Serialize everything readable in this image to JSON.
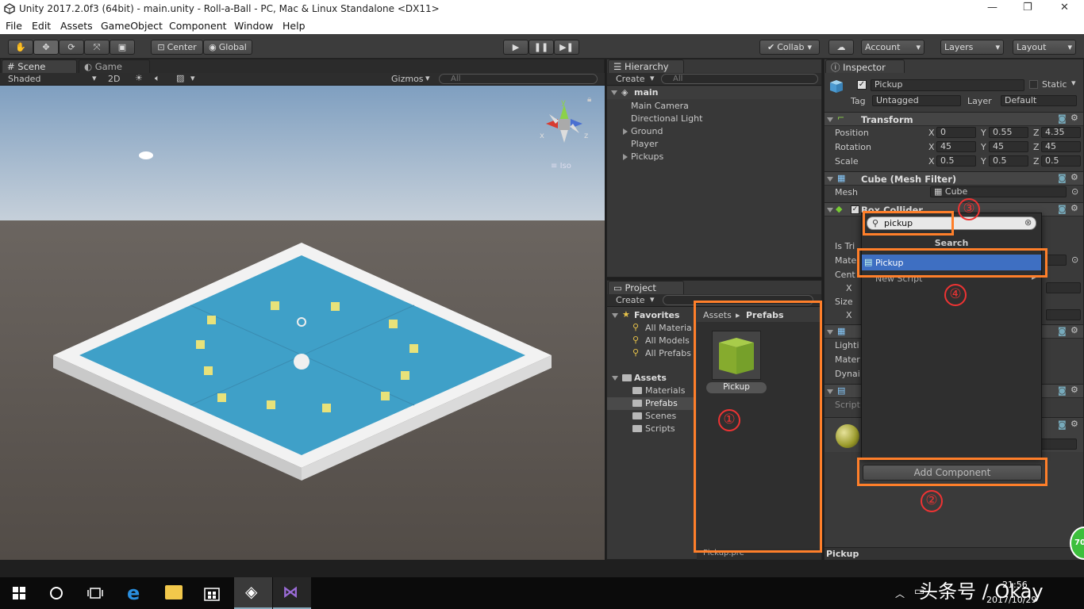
{
  "window": {
    "title": "Unity 2017.2.0f3 (64bit) - main.unity - Roll-a-Ball - PC, Mac & Linux Standalone <DX11>"
  },
  "menu": [
    "File",
    "Edit",
    "Assets",
    "GameObject",
    "Component",
    "Window",
    "Help"
  ],
  "toolbar": {
    "pivot": "Center",
    "space": "Global",
    "collab": "Collab",
    "account": "Account",
    "layers": "Layers",
    "layout": "Layout"
  },
  "scene": {
    "tab_scene": "Scene",
    "tab_game": "Game",
    "shading": "Shaded",
    "mode2d": "2D",
    "gizmos": "Gizmos",
    "search_placeholder": "All",
    "gizmo_y": "y",
    "gizmo_x": "x",
    "gizmo_z": "z",
    "iso": "Iso"
  },
  "hierarchy": {
    "tab": "Hierarchy",
    "create": "Create",
    "search_placeholder": "All",
    "scene_name": "main",
    "items": [
      "Main Camera",
      "Directional Light",
      "Ground",
      "Player",
      "Pickups"
    ]
  },
  "project": {
    "tab": "Project",
    "create": "Create",
    "breadcrumb_root": "Assets",
    "breadcrumb_current": "Prefabs",
    "favorites_label": "Favorites",
    "favorites": [
      "All Materia",
      "All Models",
      "All Prefabs"
    ],
    "assets_label": "Assets",
    "folders": [
      "Materials",
      "Prefabs",
      "Scenes",
      "Scripts"
    ],
    "asset_name": "Pickup",
    "footer_file": "Pickup.pre"
  },
  "inspector": {
    "tab": "Inspector",
    "object_name": "Pickup",
    "static_label": "Static",
    "tag_label": "Tag",
    "tag_value": "Untagged",
    "layer_label": "Layer",
    "layer_value": "Default",
    "transform": {
      "title": "Transform",
      "position_label": "Position",
      "rotation_label": "Rotation",
      "scale_label": "Scale",
      "position": {
        "x": "0",
        "y": "0.55",
        "z": "4.35"
      },
      "rotation": {
        "x": "45",
        "y": "45",
        "z": "45"
      },
      "scale": {
        "x": "0.5",
        "y": "0.5",
        "z": "0.5"
      }
    },
    "mesh_filter": {
      "title": "Cube (Mesh Filter)",
      "mesh_label": "Mesh",
      "mesh_value": "Cube"
    },
    "box_collider": {
      "title": "Box Collider",
      "partial_labels": [
        "Is Tri",
        "Mate",
        "Cent",
        "X",
        "Size",
        "X"
      ]
    },
    "renderer_partial": [
      "Lighti",
      "Mater",
      "Dynai"
    ],
    "script_partial": "Script",
    "add_component": "Add Component",
    "footer_name": "Pickup"
  },
  "popup": {
    "search_value": "pickup",
    "header": "Search",
    "result": "Pickup",
    "new_script": "New Script"
  },
  "annotations": [
    "①",
    "②",
    "③",
    "④"
  ],
  "taskbar": {
    "time": "21:56",
    "date": "2017/10/29",
    "watermark": "头条号 / Okay",
    "badge": "70"
  }
}
